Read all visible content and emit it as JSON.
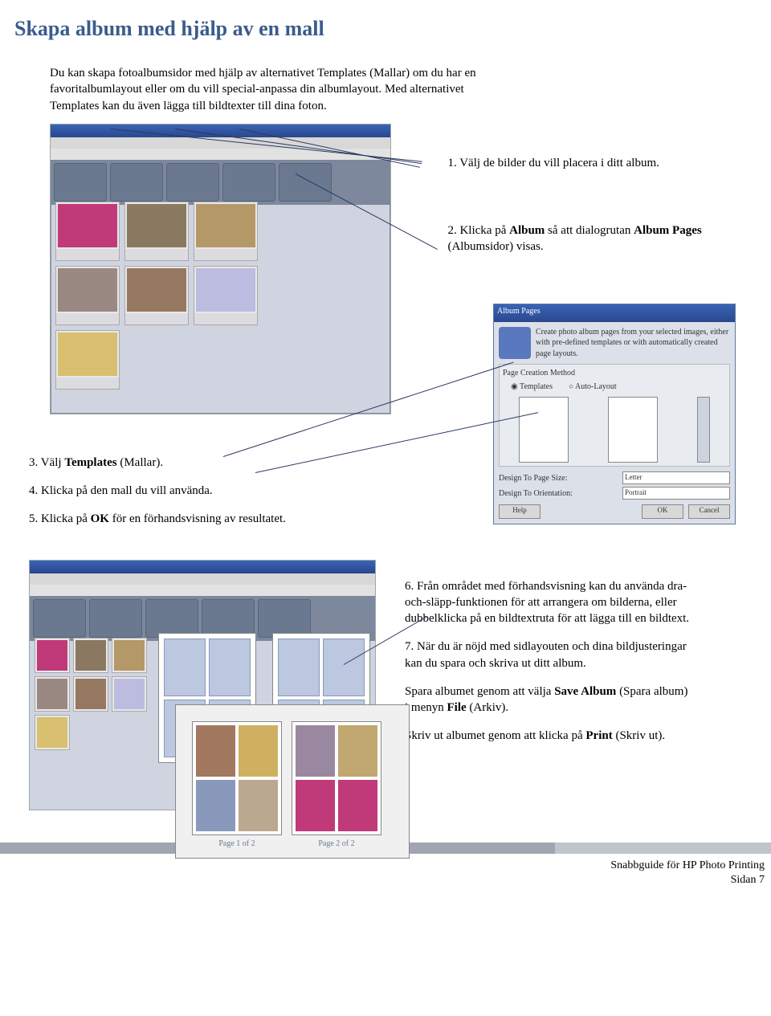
{
  "title": "Skapa album med hjälp av en mall",
  "intro": "Du kan skapa fotoalbumsidor med hjälp av alternativet Templates (Mallar) om du har en favoritalbumlayout eller om du vill special-anpassa din albumlayout. Med alternativet Templates kan du även lägga till bildtexter till dina foton.",
  "steps": {
    "s1": "1. Välj de bilder du vill placera i ditt album.",
    "s2_a": "2. Klicka på ",
    "s2_b": "Album",
    "s2_c": " så att dialogrutan ",
    "s2_d": "Album Pages",
    "s2_e": " (Albumsidor) visas.",
    "s3_a": "3. Välj ",
    "s3_b": "Templates",
    "s3_c": " (Mallar).",
    "s4": "4. Klicka på den mall du vill använda.",
    "s5_a": "5. Klicka på ",
    "s5_b": "OK",
    "s5_c": " för en förhandsvisning av resultatet.",
    "s6": "6. Från området med förhandsvisning kan du använda dra-och-släpp-funktionen för att arrangera om bilderna, eller dubbelklicka på en bildtextruta för att lägga till en bildtext.",
    "s7": "7. När du är nöjd med sidlayouten och dina bildjusteringar kan du spara och skriva ut ditt album.",
    "p8_a": "Spara albumet genom att välja ",
    "p8_b": "Save Album",
    "p8_c": " (Spara album) i menyn ",
    "p8_d": "File",
    "p8_e": " (Arkiv).",
    "p9_a": "Skriv ut albumet genom att klicka på ",
    "p9_b": "Print",
    "p9_c": " (Skriv ut)."
  },
  "dialog": {
    "title": "Album Pages",
    "desc": "Create photo album pages from your selected images, either with pre-defined templates or with automatically created page layouts.",
    "section_label": "Page Creation Method",
    "opt_templates": "Templates",
    "opt_auto": "Auto-Layout",
    "field1": "Design To Page Size:",
    "val1": "Letter",
    "field2": "Design To Orientation:",
    "val2": "Portrait",
    "btn_help": "Help",
    "btn_ok": "OK",
    "btn_cancel": "Cancel"
  },
  "preview": {
    "p1": "Page 1 of 2",
    "p2": "Page 2 of 2"
  },
  "footer": {
    "line1": "Snabbguide för HP Photo Printing",
    "line2": "Sidan 7"
  }
}
